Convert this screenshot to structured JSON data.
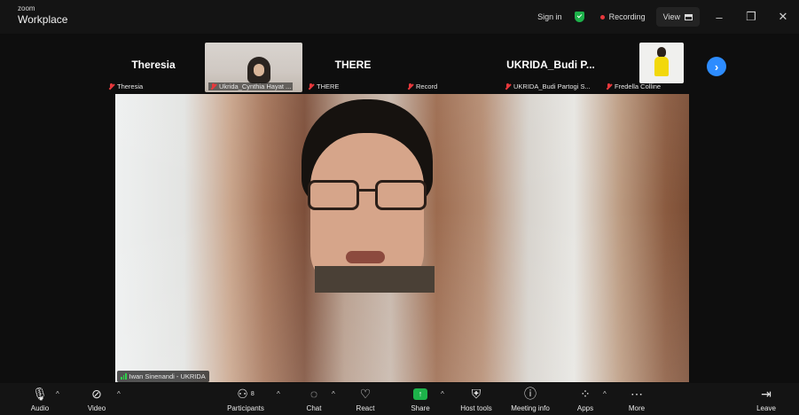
{
  "app": {
    "brand_small": "zoom",
    "brand_big": "Workplace"
  },
  "titlebar": {
    "sign_in": "Sign in",
    "recording": "Recording",
    "view": "View",
    "minimize_glyph": "–",
    "restore_glyph": "❐",
    "close_glyph": "✕"
  },
  "thumbnails": [
    {
      "name": "Theresia",
      "label": "Theresia"
    },
    {
      "name": "",
      "label": "Ukrida_Cynthia Hayat ..."
    },
    {
      "name": "THERE",
      "label": "THERE"
    },
    {
      "name": "",
      "label": "Record"
    },
    {
      "name": "UKRIDA_Budi P...",
      "label": "UKRIDA_Budi Partogi S..."
    },
    {
      "name": "",
      "label": "Fredella Colline"
    }
  ],
  "next_glyph": "›",
  "main_speaker": {
    "label": "Iwan Sinenandi - UKRIDA"
  },
  "toolbar": {
    "audio": "Audio",
    "video": "Video",
    "participants": "Participants",
    "participants_count": "8",
    "chat": "Chat",
    "react": "React",
    "share": "Share",
    "host_tools": "Host tools",
    "meeting_info": "Meeting info",
    "apps": "Apps",
    "more": "More",
    "leave": "Leave"
  },
  "icons": {
    "mic_muted": "mic-muted-icon",
    "video_off": "video-off-icon",
    "participants": "participants-icon",
    "chat": "chat-icon",
    "react": "heart-icon",
    "share": "share-screen-icon",
    "host_tools": "shield-icon",
    "meeting_info": "info-icon",
    "apps": "apps-icon",
    "more": "more-icon",
    "leave": "leave-icon"
  },
  "colors": {
    "accent": "#2d8cff",
    "recording": "#e8383c",
    "secure": "#1db24a",
    "share": "#1db24a",
    "muted": "#e8383c"
  }
}
